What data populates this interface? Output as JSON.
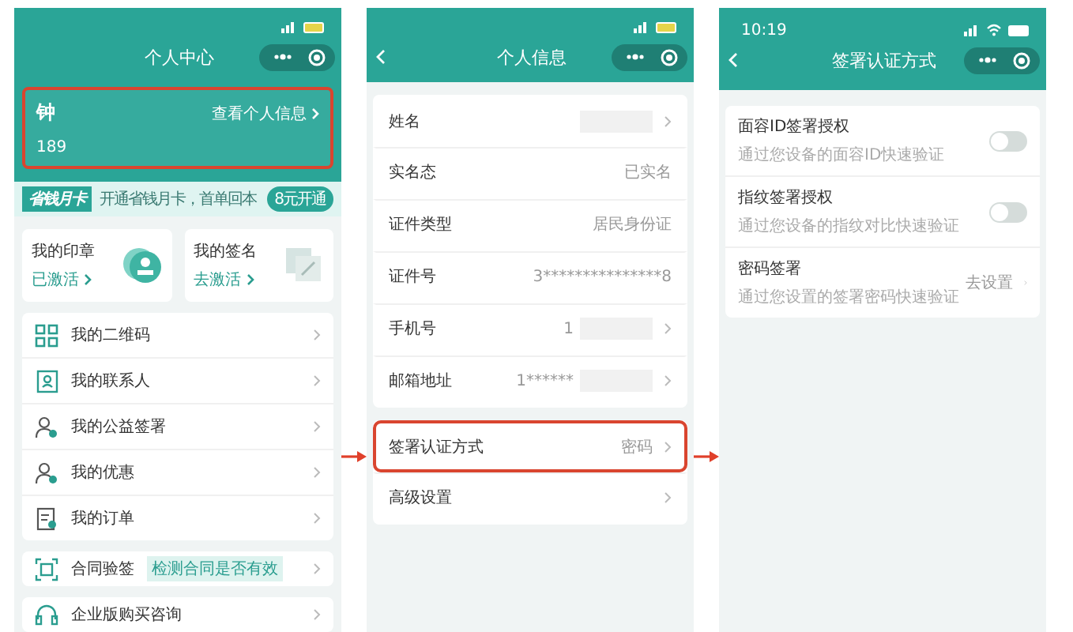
{
  "personal_center": {
    "title": "个人中心",
    "user": {
      "name": "钟",
      "phone": "189",
      "link": "查看个人信息",
      "highlighted": true
    },
    "promo": {
      "badge": "省钱月卡",
      "text": "开通省钱月卡，首单回本",
      "button": "8元开通"
    },
    "cards": [
      {
        "title": "我的印章",
        "action": "已激活"
      },
      {
        "title": "我的签名",
        "action": "去激活"
      }
    ],
    "menu": [
      {
        "label": "我的二维码"
      },
      {
        "label": "我的联系人"
      },
      {
        "label": "我的公益签署"
      },
      {
        "label": "我的优惠"
      },
      {
        "label": "我的订单"
      }
    ],
    "verify": {
      "label": "合同验签",
      "tag": "检测合同是否有效"
    },
    "consult": {
      "label": "企业版购买咨询"
    }
  },
  "personal_info": {
    "title": "个人信息",
    "rows": [
      {
        "label": "姓名",
        "value": "",
        "redacted": true,
        "chevron": true
      },
      {
        "label": "实名态",
        "value": "已实名",
        "redacted": false,
        "chevron": false
      },
      {
        "label": "证件类型",
        "value": "居民身份证",
        "redacted": false,
        "chevron": false
      },
      {
        "label": "证件号",
        "value": "3***************8",
        "redacted": false,
        "chevron": false
      },
      {
        "label": "手机号",
        "value": "1",
        "redacted": true,
        "chevron": true
      },
      {
        "label": "邮箱地址",
        "value": "1******",
        "redacted": true,
        "chevron": true
      }
    ],
    "settings": [
      {
        "label": "签署认证方式",
        "value": "密码",
        "highlighted": true
      },
      {
        "label": "高级设置",
        "highlighted": false
      }
    ]
  },
  "sign_auth": {
    "time": "10:19",
    "title": "签署认证方式",
    "options": [
      {
        "kind": "toggle",
        "title": "面容ID签署授权",
        "subtitle": "通过您设备的面容ID快速验证",
        "on": false
      },
      {
        "kind": "toggle",
        "title": "指纹签署授权",
        "subtitle": "通过您设备的指纹对比快速验证",
        "on": false
      },
      {
        "kind": "link",
        "title": "密码签署",
        "subtitle": "通过您设置的签署密码快速验证",
        "action": "去设置"
      }
    ]
  }
}
